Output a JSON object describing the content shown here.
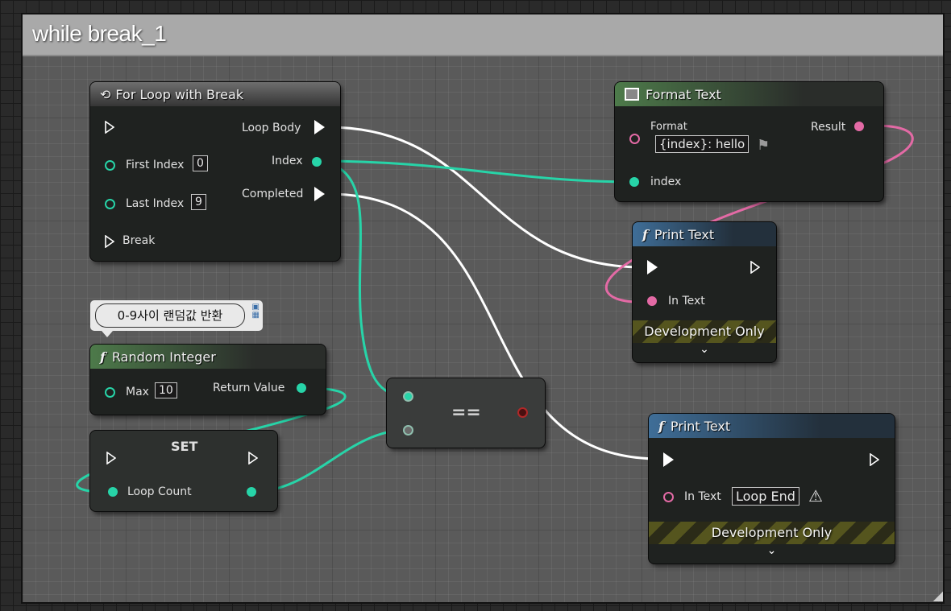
{
  "comment": {
    "title": "while break_1"
  },
  "colors": {
    "exec": "#ffffff",
    "int": "#27d4a8",
    "text": "#e36aa5"
  },
  "for_loop": {
    "title": "For Loop with Break",
    "first_index_label": "First Index",
    "first_index_value": "0",
    "last_index_label": "Last Index",
    "last_index_value": "9",
    "break_label": "Break",
    "loop_body_label": "Loop Body",
    "index_label": "Index",
    "completed_label": "Completed"
  },
  "format_text": {
    "title": "Format Text",
    "format_label": "Format",
    "format_value": "{index}: hello",
    "result_label": "Result",
    "index_label": "index"
  },
  "print_text_1": {
    "title": "Print Text",
    "in_text_label": "In Text",
    "dev_only": "Development Only",
    "chevron": "⌄"
  },
  "comment_bubble": {
    "text": "0-9사이 랜덤값 반환"
  },
  "random_integer": {
    "title": "Random Integer",
    "max_label": "Max",
    "max_value": "10",
    "return_label": "Return Value"
  },
  "set_node": {
    "title": "SET",
    "loop_count_label": "Loop Count"
  },
  "equal_node": {
    "symbol": "=="
  },
  "print_text_2": {
    "title": "Print Text",
    "in_text_label": "In Text",
    "in_text_value": "Loop End",
    "dev_only": "Development Only",
    "chevron": "⌄"
  }
}
